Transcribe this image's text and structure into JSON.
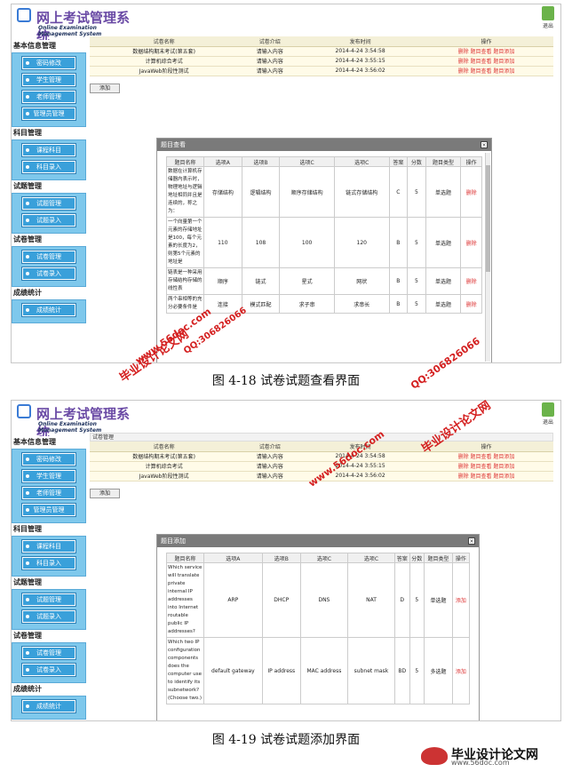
{
  "app": {
    "title_cn": "网上考试管理系统",
    "title_en": "Online Examination Management System",
    "logout_label": "退出"
  },
  "sidebar": {
    "groups": [
      {
        "label": "基本信息管理",
        "items": [
          "密码修改",
          "学生管理",
          "老师管理",
          "管理员管理"
        ]
      },
      {
        "label": "科目管理",
        "items": [
          "课程科目",
          "科目录入"
        ]
      },
      {
        "label": "试题管理",
        "items": [
          "试题管理",
          "试题录入"
        ]
      },
      {
        "label": "试卷管理",
        "items": [
          "试卷管理",
          "试卷录入"
        ]
      },
      {
        "label": "成绩统计",
        "items": [
          "成绩统计"
        ]
      }
    ]
  },
  "exam_list": {
    "breadcrumb": "试卷管理",
    "headers": [
      "试卷名称",
      "试卷介绍",
      "发布时间",
      "操作"
    ],
    "rows": [
      {
        "name": "数据结构期末考试(第五套)",
        "intro": "请输入内容",
        "time": "2014-4-24 3:54:58",
        "ops": "删除 题目查看 题目添加"
      },
      {
        "name": "计算机综合考试",
        "intro": "请输入内容",
        "time": "2014-4-24 3:55:15",
        "ops": "删除 题目查看 题目添加"
      },
      {
        "name": "JavaWeb阶段性测试",
        "intro": "请输入内容",
        "time": "2014-4-24 3:56:02",
        "ops": "删除 题目查看 题目添加"
      }
    ],
    "add_button": "添加"
  },
  "view_panel": {
    "title": "题目查看",
    "close": "×",
    "headers": [
      "题目名称",
      "选项A",
      "选项B",
      "选项C",
      "选项C",
      "答案",
      "分数",
      "题目类型",
      "操作"
    ],
    "rows": [
      {
        "name": "数据在计算机存储器内表示时，物理地址与逻辑地址相同并且是连续的，称之为：",
        "a": "存储结构",
        "b": "逻辑结构",
        "c": "顺序存储结构",
        "d": "链式存储结构",
        "ans": "C",
        "score": "5",
        "type": "单选题",
        "op": "删除"
      },
      {
        "name": "一个向量第一个元素的存储地址是100，每个元素的长度为2，则第5个元素的地址是",
        "a": "110",
        "b": "108",
        "c": "100",
        "d": "120",
        "ans": "B",
        "score": "5",
        "type": "单选题",
        "op": "删除"
      },
      {
        "name": "链表是一种采用存储结构存储的线性表",
        "a": "顺序",
        "b": "链式",
        "c": "星式",
        "d": "网状",
        "ans": "B",
        "score": "5",
        "type": "单选题",
        "op": "删除"
      },
      {
        "name": "两个串相等的充分必要条件是",
        "a": "连接",
        "b": "模式匹配",
        "c": "求子串",
        "d": "求串长",
        "ans": "B",
        "score": "5",
        "type": "单选题",
        "op": "删除"
      }
    ]
  },
  "add_panel": {
    "title": "题目添加",
    "close": "×",
    "headers": [
      "题目名称",
      "选项A",
      "选项B",
      "选项C",
      "选项C",
      "答案",
      "分数",
      "题目类型",
      "操作"
    ],
    "rows": [
      {
        "name": "Which service will translate private internal IP addresses into Internet routable public IP addresses?",
        "a": "ARP",
        "b": "DHCP",
        "c": "DNS",
        "d": "NAT",
        "ans": "D",
        "score": "5",
        "type": "单选题",
        "op": "添加"
      },
      {
        "name": "Which two IP configuration components does the computer use to identify its subnetwork? (Choose two.)",
        "a": "default gateway",
        "b": "IP address",
        "c": "MAC address",
        "d": "subnet mask",
        "ans": "BD",
        "score": "5",
        "type": "多选题",
        "op": "添加"
      }
    ]
  },
  "captions": {
    "fig1": "图 4-18  试卷试题查看界面",
    "fig2": "图 4-19  试卷试题添加界面"
  },
  "watermarks": {
    "site": "www.56doc.com",
    "qq": "QQ:306826066",
    "brand": "毕业设计论文网"
  },
  "footer": {
    "brand_cn": "毕业设计论文网",
    "brand_url": "www.56doc.com"
  }
}
